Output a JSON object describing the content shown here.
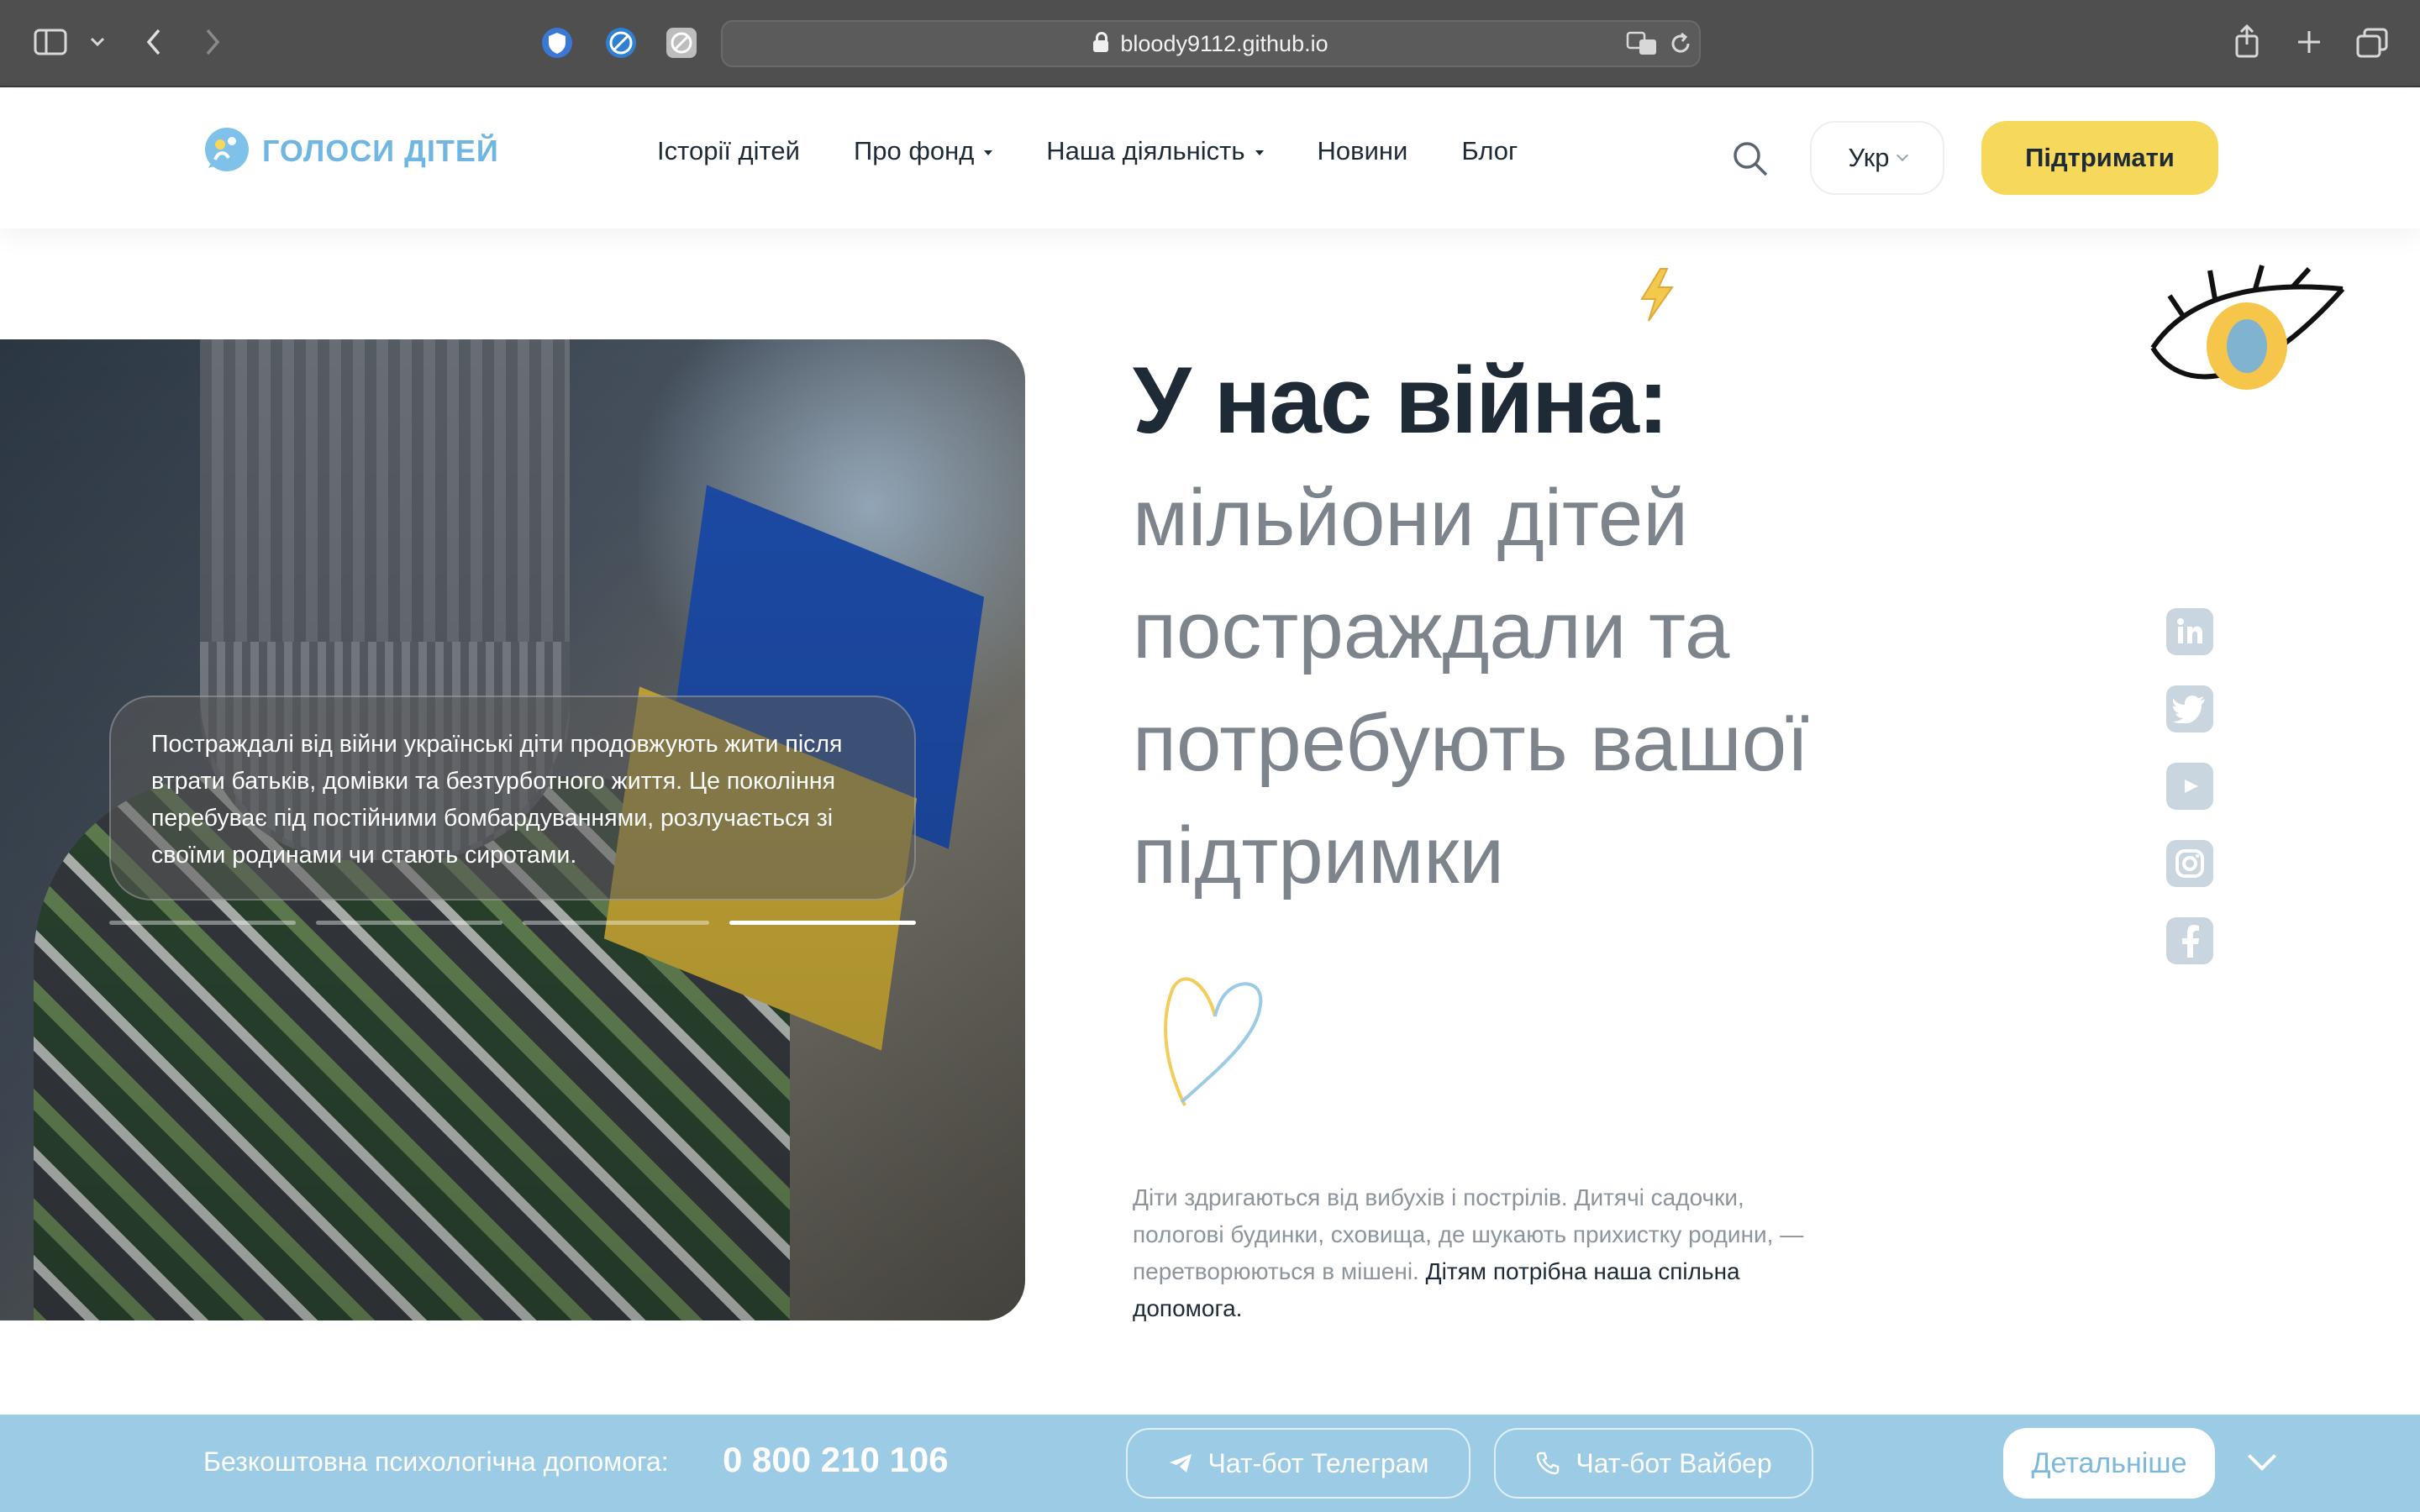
{
  "browser": {
    "url": "bloody9112.github.io"
  },
  "header": {
    "logo_text": "ГОЛОСИ ДІТЕЙ",
    "nav": [
      {
        "label": "Історії дітей",
        "dropdown": false
      },
      {
        "label": "Про фонд",
        "dropdown": true
      },
      {
        "label": "Наша діяльність",
        "dropdown": true
      },
      {
        "label": "Новини",
        "dropdown": false
      },
      {
        "label": "Блог",
        "dropdown": false
      }
    ],
    "language": "Укр",
    "support_label": "Підтримати"
  },
  "hero": {
    "title": "У нас війна:",
    "subtitle": "мільйони дітей постраждали та потребують вашої підтримки",
    "caption": "Постраждалі від війни українські діти продовжують жити після втрати батьків, домівки та безтурботного життя. Це покоління перебуває під постійними бомбардуваннями, розлучається зі своїми родинами чи стають сиротами.",
    "slides_total": 4,
    "active_slide": 4,
    "body": "Діти здригаються від вибухів і пострілів. Дитячі садочки, пологові будинки, сховища, де шукають прихистку родини, — перетворюються в мішені.",
    "body_strong": "Дітям потрібна наша спільна допомога."
  },
  "socials": [
    "linkedin-icon",
    "twitter-icon",
    "youtube-icon",
    "instagram-icon",
    "facebook-icon"
  ],
  "bottom_bar": {
    "label": "Безкоштовна психологічна допомога:",
    "phone": "0 800 210 106",
    "telegram_label": "Чат-бот Телеграм",
    "viber_label": "Чат-бот Вайбер",
    "more_label": "Детальніше"
  },
  "colors": {
    "accent_yellow": "#f6d95a",
    "accent_blue": "#9ccbe6",
    "text_dark": "#1f2a37",
    "chrome": "#4f4f4f"
  }
}
